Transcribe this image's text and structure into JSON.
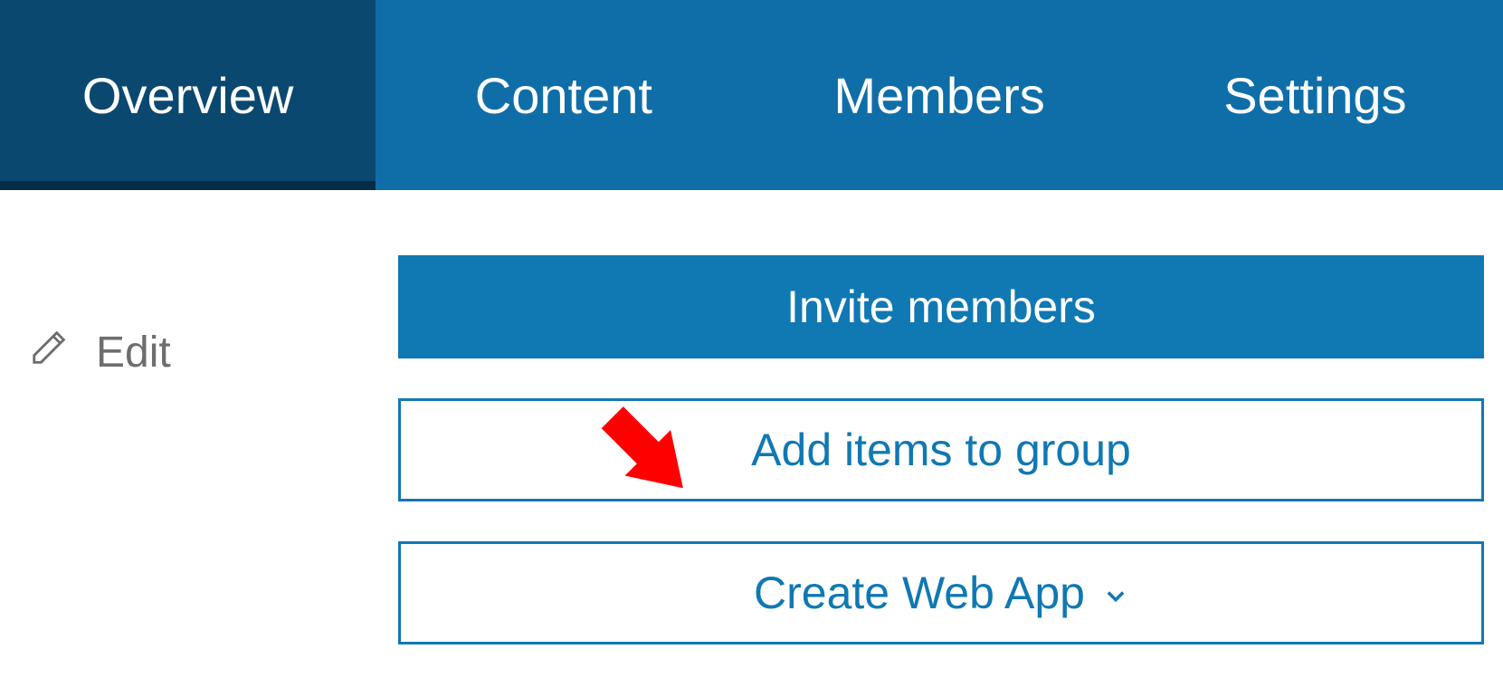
{
  "tabs": [
    {
      "label": "Overview",
      "active": true
    },
    {
      "label": "Content",
      "active": false
    },
    {
      "label": "Members",
      "active": false
    },
    {
      "label": "Settings",
      "active": false
    }
  ],
  "edit": {
    "label": "Edit"
  },
  "actions": {
    "invite": "Invite members",
    "add_items": "Add items to group",
    "create_app": "Create Web App"
  },
  "colors": {
    "tab_bg": "#0f6ea8",
    "tab_active": "#0a4870",
    "primary": "#1078b3",
    "annotation": "#ff0000"
  }
}
